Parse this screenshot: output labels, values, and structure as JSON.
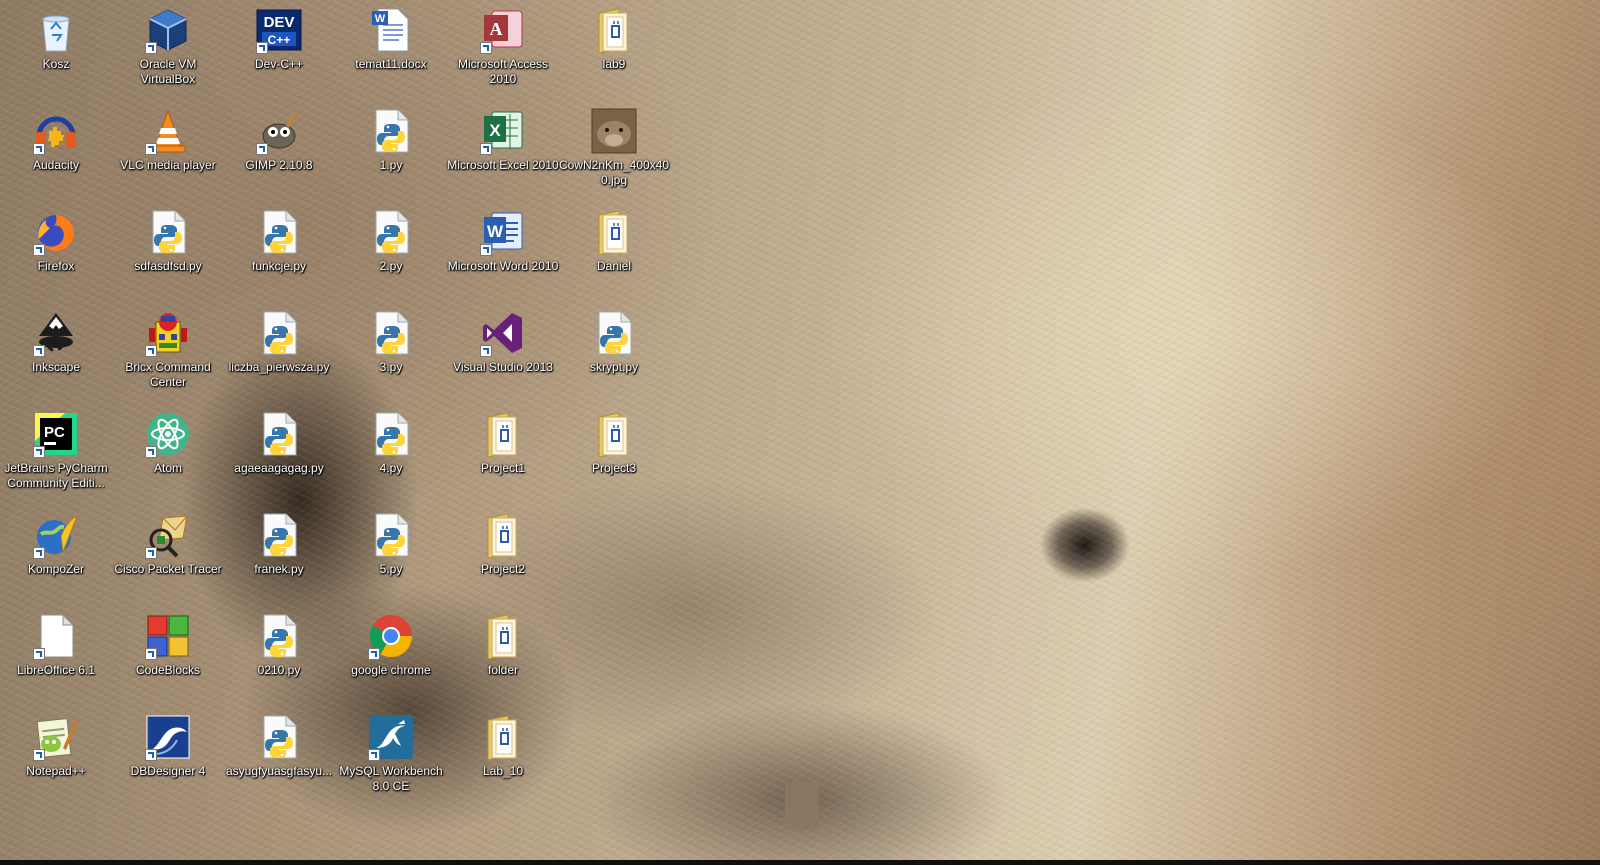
{
  "desktop": {
    "icons": [
      {
        "label": "Kosz",
        "icon": "recycle-bin-icon"
      },
      {
        "label": "Oracle VM VirtualBox",
        "icon": "virtualbox-icon"
      },
      {
        "label": "Dev-C++",
        "icon": "devcpp-icon"
      },
      {
        "label": "temat11.docx",
        "icon": "word-document-icon"
      },
      {
        "label": "Microsoft Access 2010",
        "icon": "access-icon"
      },
      {
        "label": "lab9",
        "icon": "folder-icon"
      },
      {
        "label": "Audacity",
        "icon": "audacity-icon"
      },
      {
        "label": "VLC media player",
        "icon": "vlc-icon"
      },
      {
        "label": "GIMP 2.10.8",
        "icon": "gimp-icon"
      },
      {
        "label": "1.py",
        "icon": "python-file-icon"
      },
      {
        "label": "Microsoft Excel 2010",
        "icon": "excel-icon"
      },
      {
        "label": "CowN2nKm_400x400.jpg",
        "icon": "image-file-icon"
      },
      {
        "label": "Firefox",
        "icon": "firefox-icon"
      },
      {
        "label": "sdfasdfsd.py",
        "icon": "python-file-icon"
      },
      {
        "label": "funkcje.py",
        "icon": "python-file-icon"
      },
      {
        "label": "2.py",
        "icon": "python-file-icon"
      },
      {
        "label": "Microsoft Word 2010",
        "icon": "word-icon"
      },
      {
        "label": "Daniel",
        "icon": "folder-icon"
      },
      {
        "label": "Inkscape",
        "icon": "inkscape-icon"
      },
      {
        "label": "Bricx Command Center",
        "icon": "bricx-icon"
      },
      {
        "label": "liczba_pierwsza.py",
        "icon": "python-file-icon"
      },
      {
        "label": "3.py",
        "icon": "python-file-icon"
      },
      {
        "label": "Visual Studio 2013",
        "icon": "visual-studio-icon"
      },
      {
        "label": "skrypt.py",
        "icon": "python-file-icon"
      },
      {
        "label": "JetBrains PyCharm Community Editi...",
        "icon": "pycharm-icon"
      },
      {
        "label": "Atom",
        "icon": "atom-icon"
      },
      {
        "label": "agaeaagagag.py",
        "icon": "python-file-icon"
      },
      {
        "label": "4.py",
        "icon": "python-file-icon"
      },
      {
        "label": "Project1",
        "icon": "folder-icon"
      },
      {
        "label": "Project3",
        "icon": "folder-icon"
      },
      {
        "label": "KompoZer",
        "icon": "kompozer-icon"
      },
      {
        "label": "Cisco Packet Tracer",
        "icon": "packet-tracer-icon"
      },
      {
        "label": "franek.py",
        "icon": "python-file-icon"
      },
      {
        "label": "5.py",
        "icon": "python-file-icon"
      },
      {
        "label": "Project2",
        "icon": "folder-icon"
      },
      {
        "label": "LibreOffice 6.1",
        "icon": "libreoffice-icon"
      },
      {
        "label": "CodeBlocks",
        "icon": "codeblocks-icon"
      },
      {
        "label": "0210.py",
        "icon": "python-file-icon"
      },
      {
        "label": "google chrome",
        "icon": "chrome-icon"
      },
      {
        "label": "folder",
        "icon": "folder-icon"
      },
      {
        "label": "Notepad++",
        "icon": "notepadpp-icon"
      },
      {
        "label": "DBDesigner 4",
        "icon": "dbdesigner-icon"
      },
      {
        "label": "asyugfyuasgfasyu...",
        "icon": "python-file-icon"
      },
      {
        "label": "MySQL Workbench 8.0 CE",
        "icon": "mysql-workbench-icon"
      },
      {
        "label": "Lab_10",
        "icon": "folder-icon"
      }
    ]
  }
}
